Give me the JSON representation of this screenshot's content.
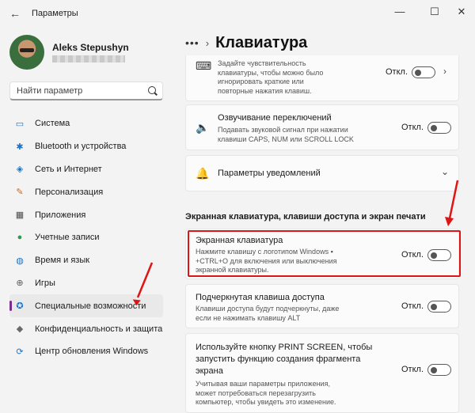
{
  "window": {
    "title": "Параметры",
    "back_glyph": "←",
    "minimize_glyph": "—",
    "maximize_glyph": "☐",
    "close_glyph": "✕"
  },
  "user": {
    "name": "Aleks Stepushyn"
  },
  "search": {
    "placeholder": "Найти параметр"
  },
  "sidebar": {
    "items": [
      {
        "label": "Система",
        "icon": "monitor-icon",
        "glyph": "▭",
        "color": "#1a73c7"
      },
      {
        "label": "Bluetooth и устройства",
        "icon": "bluetooth-icon",
        "glyph": "✱",
        "color": "#1a73c7"
      },
      {
        "label": "Сеть и Интернет",
        "icon": "wifi-icon",
        "glyph": "◈",
        "color": "#1a73c7"
      },
      {
        "label": "Персонализация",
        "icon": "brush-icon",
        "glyph": "✎",
        "color": "#c06a2a"
      },
      {
        "label": "Приложения",
        "icon": "apps-icon",
        "glyph": "▦",
        "color": "#4a4a4a"
      },
      {
        "label": "Учетные записи",
        "icon": "person-icon",
        "glyph": "●",
        "color": "#2e9a4f"
      },
      {
        "label": "Время и язык",
        "icon": "globe-icon",
        "glyph": "◍",
        "color": "#1a73c7"
      },
      {
        "label": "Игры",
        "icon": "gamepad-icon",
        "glyph": "⊕",
        "color": "#5a5a5a"
      },
      {
        "label": "Специальные возможности",
        "icon": "accessibility-icon",
        "glyph": "✪",
        "color": "#1a73c7",
        "active": true
      },
      {
        "label": "Конфиденциальность и защита",
        "icon": "shield-icon",
        "glyph": "◆",
        "color": "#6a6a6a"
      },
      {
        "label": "Центр обновления Windows",
        "icon": "update-icon",
        "glyph": "⟳",
        "color": "#1a73c7"
      }
    ]
  },
  "breadcrumb": {
    "dots": "•••",
    "separator": "›",
    "title": "Клавиатура"
  },
  "settings": {
    "sticky_partial": {
      "desc": "Задайте чувствительность\nклавиатуры, чтобы можно было\nигнорировать краткие или\nповторные нажатия клавиш.",
      "state": "Откл.",
      "on": false,
      "chevron": "›"
    },
    "toggle_sounds": {
      "title": "Озвучивание переключений",
      "desc": "Подавать звуковой сигнал при нажатии\nклавиши CAPS, NUM или SCROLL LOCK",
      "state": "Откл.",
      "on": false
    },
    "notifications": {
      "title": "Параметры уведомлений",
      "chevron": "⌄"
    },
    "section_title": "Экранная клавиатура, клавиши доступа и экран печати",
    "onscreen_keyboard": {
      "title": "Экранная клавиатура",
      "desc": "Нажмите клавишу с логотипом Windows ▪\n+CTRL+O для включения или выключения\nэкранной клавиатуры.",
      "state": "Откл.",
      "on": false
    },
    "underline_access": {
      "title": "Подчеркнутая клавиша доступа",
      "desc": "Клавиши доступа будут подчеркнуты, даже\nесли не нажимать клавишу ALT",
      "state": "Откл.",
      "on": false
    },
    "print_screen": {
      "title": "Используйте кнопку PRINT SCREEN, чтобы\nзапустить функцию создания фрагмента\nэкрана",
      "desc": "Учитывая ваши параметры приложения,\nможет потребоваться перезагрузить\nкомпьютер, чтобы увидеть это изменение.",
      "state": "Откл.",
      "on": false
    }
  },
  "colors": {
    "accent": "#7a2f8e",
    "highlight": "#e01414"
  }
}
